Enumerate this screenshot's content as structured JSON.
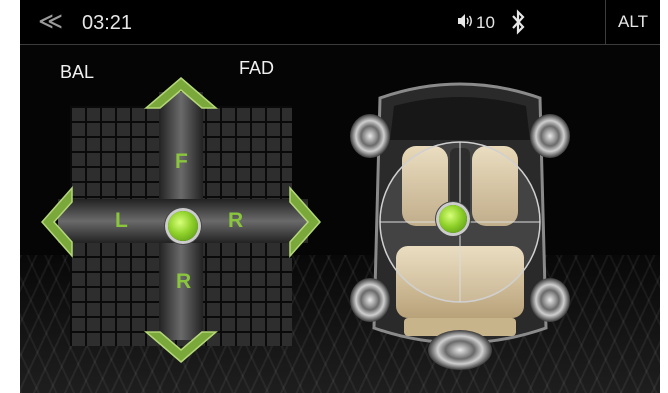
{
  "status_bar": {
    "back_label": "≪",
    "time": "03:21",
    "volume_icon": "speaker-volume-icon",
    "volume": "10",
    "bluetooth_icon": "bluetooth-icon",
    "alt_label": "ALT"
  },
  "balance_panel": {
    "bal_label": "BAL",
    "fad_label": "FAD",
    "front": "F",
    "left": "L",
    "right": "R",
    "rear": "R",
    "arrow_icons": [
      "arrow-up-icon",
      "arrow-down-icon",
      "arrow-left-icon",
      "arrow-right-icon"
    ]
  },
  "car_view": {
    "icon": "car-top-view-icon",
    "speakers": [
      "front-left",
      "front-right",
      "rear-left",
      "rear-right",
      "subwoofer"
    ]
  },
  "colors": {
    "accent": "#8ac53e",
    "background": "#050505",
    "text": "#e6e6e6"
  }
}
